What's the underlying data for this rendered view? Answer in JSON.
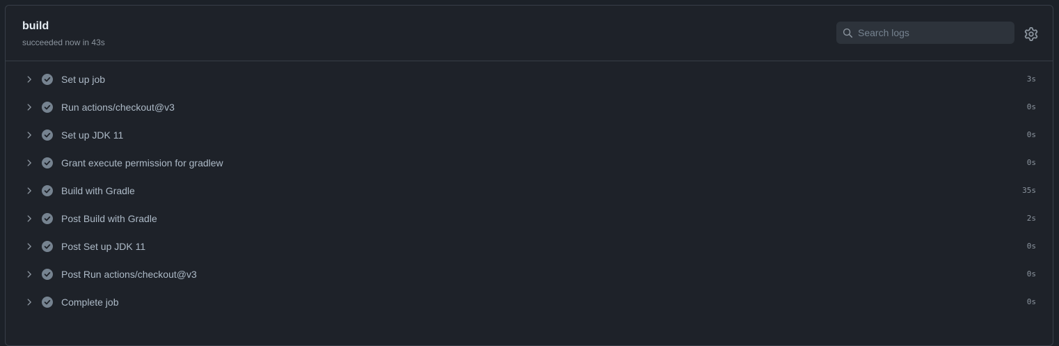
{
  "job": {
    "title": "build",
    "status": "succeeded now in 43s"
  },
  "search": {
    "placeholder": "Search logs",
    "value": ""
  },
  "icons": {
    "search": "search-icon",
    "settings": "gear-icon",
    "expand": "chevron-right-icon",
    "success": "check-circle-icon"
  },
  "colors": {
    "background": "#1e2229",
    "border": "#373e47",
    "title": "#e6edf3",
    "muted": "#8b949e",
    "step_text": "#adbac7",
    "success_icon": "#768390"
  },
  "steps": [
    {
      "name": "Set up job",
      "duration": "3s"
    },
    {
      "name": "Run actions/checkout@v3",
      "duration": "0s"
    },
    {
      "name": "Set up JDK 11",
      "duration": "0s"
    },
    {
      "name": "Grant execute permission for gradlew",
      "duration": "0s"
    },
    {
      "name": "Build with Gradle",
      "duration": "35s"
    },
    {
      "name": "Post Build with Gradle",
      "duration": "2s"
    },
    {
      "name": "Post Set up JDK 11",
      "duration": "0s"
    },
    {
      "name": "Post Run actions/checkout@v3",
      "duration": "0s"
    },
    {
      "name": "Complete job",
      "duration": "0s"
    }
  ]
}
